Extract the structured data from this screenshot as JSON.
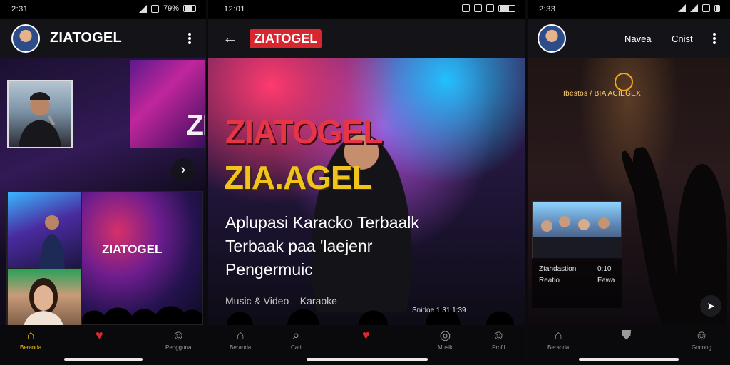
{
  "phone1": {
    "status": {
      "time": "2:31",
      "battery": "79%"
    },
    "brand": "ZIATOGEL",
    "banner_text": "ZI",
    "stage_text": "ZIATOGEL",
    "nav": [
      {
        "label": "Beranda",
        "icon": "home-icon"
      },
      {
        "label": "",
        "icon": "heart-icon"
      },
      {
        "label": "Pengguna",
        "icon": "user-icon"
      }
    ]
  },
  "phone2": {
    "status": {
      "time": "12:01"
    },
    "brand": "ZIATOGEL",
    "logo_line1": "ZIATOGEL",
    "logo_line2": "ZIA.AGEL",
    "title_lines": [
      "Aplupasi Karacko Terbaalk",
      "Terbaak paa 'laejenr",
      "Pengermuic"
    ],
    "subtitle": "Music & Video – Karaoke",
    "caption": "Snidoe 1:31 1:39",
    "nav": [
      {
        "label": "Beranda",
        "icon": "home-icon"
      },
      {
        "label": "Cari",
        "icon": "search-icon"
      },
      {
        "label": "",
        "icon": "heart-icon"
      },
      {
        "label": "Musik",
        "icon": "music-icon"
      },
      {
        "label": "Profil",
        "icon": "user-icon"
      }
    ]
  },
  "phone3": {
    "status": {
      "time": "2:33"
    },
    "menu": [
      "Navea",
      "Cnist"
    ],
    "neon_sign": "Ibestos / BIA ACIEGEX",
    "info_lines": [
      [
        "Ztahdastion",
        "0:10"
      ],
      [
        "Reatio",
        "Fawa"
      ]
    ],
    "nav": [
      {
        "label": "Beranda",
        "icon": "home-icon"
      },
      {
        "label": "",
        "icon": "shield-icon"
      },
      {
        "label": "Gocong",
        "icon": "user-icon"
      }
    ]
  }
}
